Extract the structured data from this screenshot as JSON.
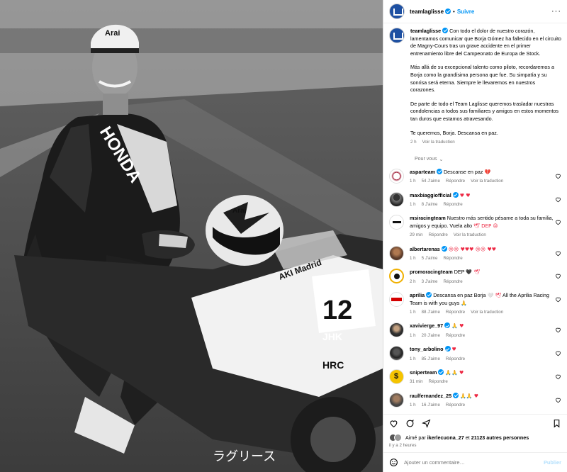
{
  "post": {
    "author": "teamlaglisse",
    "follow_label": "Suivre",
    "more_icon": "more-icon",
    "caption": {
      "author": "teamlaglisse",
      "paragraphs": [
        "Con todo el dolor de nuestro corazón, lamentamos comunicar que Borja Gómez ha fallecido en el circuito de Magny-Cours tras un grave accidente en el primer entrenamiento libre del Campeonato de Europa de Stock.",
        "Más allá de su excepcional talento como piloto, recordaremos a Borja como la grandísima persona que fue. Su simpatía y su sonrisa será eterna. Siempre le llevaremos en nuestros corazones.",
        "De parte de todo el Team Laglisse queremos trasladar nuestras condolencias a todos sus familiares y amigos en estos momentos tan duros que estamos atravesando.",
        "Te queremos, Borja. Descansa en paz."
      ],
      "time": "2 h",
      "translate": "Voir la traduction"
    },
    "language_label": "Pour vous",
    "comments": [
      {
        "user": "asparteam",
        "verified": true,
        "text": "Descanse en paz",
        "emoji": "💔",
        "time": "1 h",
        "likes": "54 J'aime",
        "reply": "Répondre",
        "translate": "Voir la traduction"
      },
      {
        "user": "maxbiaggiofficial",
        "verified": true,
        "text": "",
        "emoji": "♥ ♥",
        "time": "1 h",
        "likes": "8 J'aime",
        "reply": "Répondre",
        "translate": ""
      },
      {
        "user": "msiracingteam",
        "verified": false,
        "text": "Nuestro más sentido pésame a toda su familia, amigos y equipo. Vuela alto",
        "emoji": "🕊 DEP 😢",
        "time": "29 min",
        "likes": "",
        "reply": "Répondre",
        "translate": "Voir la traduction"
      },
      {
        "user": "albertarenas",
        "verified": true,
        "text": "",
        "emoji": "😢😢 ♥♥♥ 😢😢 ♥♥",
        "time": "1 h",
        "likes": "5 J'aime",
        "reply": "Répondre",
        "translate": ""
      },
      {
        "user": "promoracingteam",
        "verified": false,
        "text": "DEP",
        "emoji": "🖤 🕊",
        "time": "2 h",
        "likes": "3 J'aime",
        "reply": "Répondre",
        "translate": ""
      },
      {
        "user": "aprilia",
        "verified": true,
        "text": "Descansa en paz Borja",
        "emoji_mid": "🤍 🕊",
        "text2": "All the Aprilia Racing Team is with you guys",
        "emoji": "🙏",
        "time": "1 h",
        "likes": "88 J'aime",
        "reply": "Répondre",
        "translate": "Voir la traduction"
      },
      {
        "user": "xavivierge_97",
        "verified": true,
        "text": "",
        "emoji": "🙏 ♥",
        "time": "1 h",
        "likes": "20 J'aime",
        "reply": "Répondre",
        "translate": ""
      },
      {
        "user": "tony_arbolino",
        "verified": true,
        "text": "",
        "emoji": "♥",
        "time": "1 h",
        "likes": "85 J'aime",
        "reply": "Répondre",
        "translate": ""
      },
      {
        "user": "sniperteam",
        "verified": true,
        "text": "",
        "emoji": "🙏🙏 ♥",
        "time": "31 min",
        "likes": "",
        "reply": "Répondre",
        "translate": ""
      },
      {
        "user": "raulfernandez_25",
        "verified": true,
        "text": "",
        "emoji": "🙏🙏 ♥",
        "time": "1 h",
        "likes": "16 J'aime",
        "reply": "Répondre",
        "translate": ""
      }
    ],
    "likes_summary": {
      "prefix": "Aimé par ",
      "user": "ikerlecuona_27",
      "middle": " et ",
      "count": "21123 autres personnes"
    },
    "posted_ago": "il y a 2 heures",
    "add_comment_placeholder": "Ajouter un commentaire…",
    "publish_label": "Publier"
  },
  "photo": {
    "helmet_brand": "Arai",
    "bike_brand": "HONDA",
    "bike_number": "12",
    "sponsor_1": "AKI Madrid",
    "sponsor_2": "JHK",
    "sponsor_3": "HRC",
    "jp_text": "ラグリース"
  },
  "colors": {
    "link": "#0095f6",
    "heart": "#ed2944",
    "muted": "#737373",
    "publish_disabled": "#b2dffc"
  }
}
